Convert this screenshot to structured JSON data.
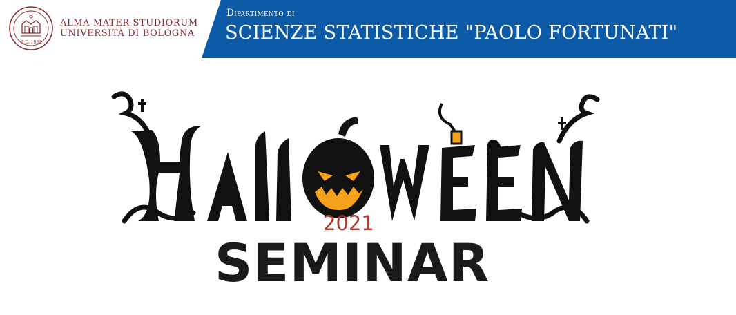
{
  "university": {
    "line1": "ALMA MATER STUDIORUM",
    "line2": "UNIVERSITÀ DI BOLOGNA",
    "seal_text": "A.D. 1088",
    "color": "#8a2c2c"
  },
  "department": {
    "label": "Dipartimento di",
    "name": "SCIENZE STATISTICHE \"PAOLO FORTUNATI\"",
    "band_color": "#0d5aa7"
  },
  "event": {
    "logo_text": "HALLOWEEN",
    "year": "2021",
    "title": "SEMINAR",
    "year_color": "#b03a2e",
    "pumpkin_color": "#f5a11c"
  }
}
